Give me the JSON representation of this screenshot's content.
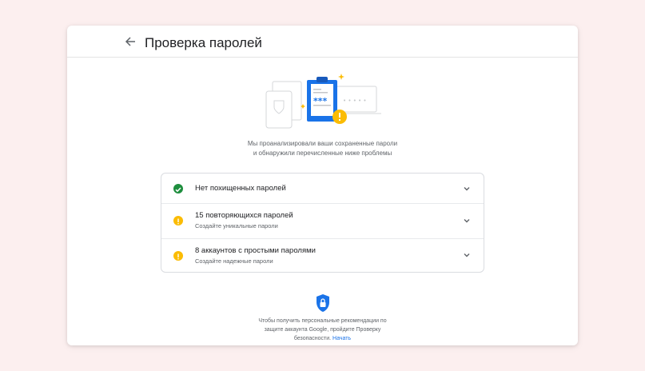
{
  "header": {
    "title": "Проверка паролей"
  },
  "illustration": {
    "masked_password": "***",
    "dots": "• • • • •"
  },
  "description": {
    "line1": "Мы проанализировали ваши сохраненные пароли",
    "line2": "и обнаружили перечисленные ниже проблемы"
  },
  "checks": [
    {
      "icon": "check-circle-icon",
      "status": "ok",
      "title": "Нет похищенных паролей"
    },
    {
      "icon": "warning-icon",
      "status": "warning",
      "title": "15 повторяющихся паролей",
      "subtitle": "Создайте уникальные пароли"
    },
    {
      "icon": "warning-icon",
      "status": "warning",
      "title": "8 аккаунтов с простыми паролями",
      "subtitle": "Создайте надежные пароли"
    }
  ],
  "footer": {
    "line1": "Чтобы получить персональные рекомендации по",
    "line2": "защите аккаунта Google, пройдите Проверку",
    "line3": "безопасности.",
    "link": "Начать"
  },
  "colors": {
    "ok": "#1e8e3e",
    "warning": "#fbbc04",
    "accent": "#1a73e8",
    "background": "#fcefef"
  }
}
